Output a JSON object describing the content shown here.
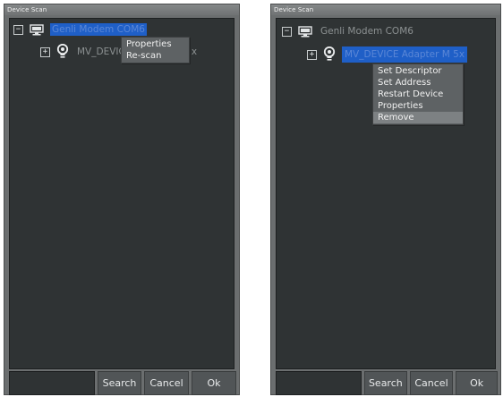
{
  "panels": [
    {
      "title": "Device Scan",
      "tree": {
        "root": {
          "expander": "−",
          "label": "Genli Modem COM6",
          "icon": "monitor-icon"
        },
        "child": {
          "expander": "+",
          "label": "MV_DEVICE Adapter M 5x",
          "icon": "bulb-icon"
        }
      },
      "context_menu": [
        "Properties",
        "Re-scan"
      ],
      "buttons": {
        "search": "Search",
        "cancel": "Cancel",
        "ok": "Ok"
      }
    },
    {
      "title": "Device Scan",
      "tree": {
        "root": {
          "expander": "−",
          "label": "Genli Modem COM6",
          "icon": "monitor-icon"
        },
        "child": {
          "expander": "+",
          "label": "MV_DEVICE Adapter M 5x",
          "icon": "bulb-icon"
        }
      },
      "context_menu": [
        "Set Descriptor",
        "Set Address",
        "Restart Device",
        "Properties",
        "Remove"
      ],
      "buttons": {
        "search": "Search",
        "cancel": "Cancel",
        "ok": "Ok"
      }
    }
  ]
}
